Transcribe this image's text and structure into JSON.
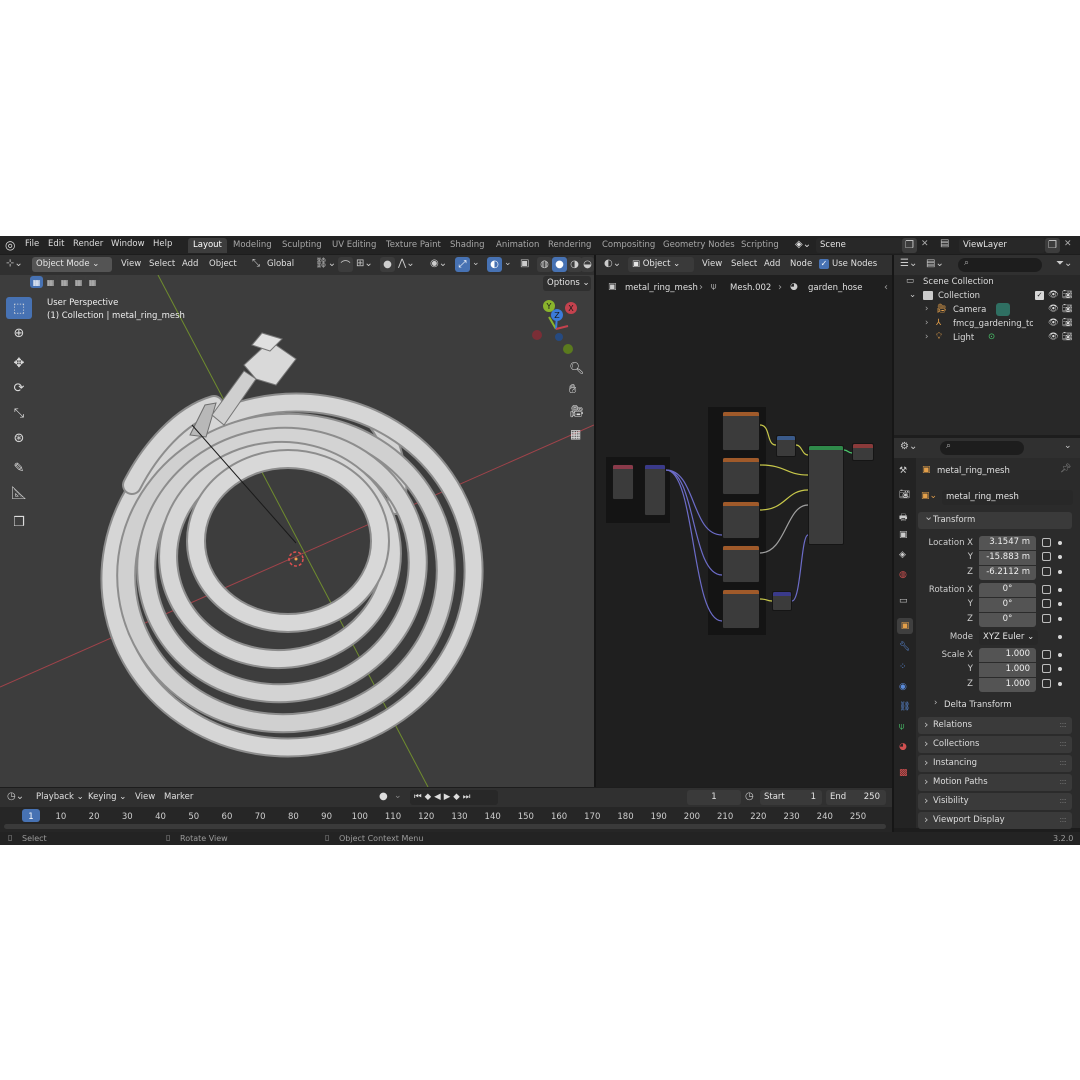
{
  "topbar": {
    "menus": [
      "File",
      "Edit",
      "Render",
      "Window",
      "Help"
    ],
    "workspaces": [
      "Layout",
      "Modeling",
      "Sculpting",
      "UV Editing",
      "Texture Paint",
      "Shading",
      "Animation",
      "Rendering",
      "Compositing",
      "Geometry Nodes",
      "Scripting"
    ],
    "active_workspace": "Layout",
    "scene": "Scene",
    "view_layer": "ViewLayer"
  },
  "viewport": {
    "mode": "Object Mode",
    "menus": [
      "View",
      "Select",
      "Add",
      "Object"
    ],
    "transform_orientation": "Global",
    "options_label": "Options",
    "perspective_label": "User Perspective",
    "collection_label": "(1) Collection | metal_ring_mesh",
    "gizmo_axes": [
      "X",
      "Y",
      "Z"
    ]
  },
  "node_editor": {
    "object_type": "Object",
    "menus": [
      "View",
      "Select",
      "Add",
      "Node"
    ],
    "use_nodes_label": "Use Nodes",
    "use_nodes_checked": true,
    "breadcrumb": [
      "metal_ring_mesh",
      "Mesh.002",
      "garden_hose"
    ]
  },
  "outliner": {
    "root": "Scene Collection",
    "items": [
      {
        "label": "Collection",
        "depth": 0
      },
      {
        "label": "Camera",
        "depth": 1
      },
      {
        "label": "fmcg_gardening_tool",
        "depth": 1
      },
      {
        "label": "Light",
        "depth": 1
      }
    ]
  },
  "properties": {
    "object_name": "metal_ring_mesh",
    "data_name": "metal_ring_mesh",
    "transform_title": "Transform",
    "location_label": "Location X",
    "location": [
      "3.1547 m",
      "-15.883 m",
      "-6.2112 m"
    ],
    "rotation_label": "Rotation X",
    "rotation": [
      "0°",
      "0°",
      "0°"
    ],
    "mode_label": "Mode",
    "rotation_mode": "XYZ Euler",
    "scale_label": "Scale X",
    "scale": [
      "1.000",
      "1.000",
      "1.000"
    ],
    "axis_y": "Y",
    "axis_z": "Z",
    "delta_transform": "Delta Transform",
    "panels": [
      "Relations",
      "Collections",
      "Instancing",
      "Motion Paths",
      "Visibility",
      "Viewport Display"
    ]
  },
  "timeline": {
    "menus": [
      "Playback",
      "Keying",
      "View",
      "Marker"
    ],
    "current_frame": "1",
    "start_label": "Start",
    "start": "1",
    "end_label": "End",
    "end": "250",
    "ticks": [
      "1",
      "10",
      "20",
      "30",
      "40",
      "50",
      "60",
      "70",
      "80",
      "90",
      "100",
      "110",
      "120",
      "130",
      "140",
      "150",
      "160",
      "170",
      "180",
      "190",
      "200",
      "210",
      "220",
      "230",
      "240",
      "250"
    ]
  },
  "statusbar": {
    "select": "Select",
    "rotate_view": "Rotate View",
    "context_menu": "Object Context Menu",
    "version": "3.2.0"
  },
  "colors": {
    "accent": "#4772b3",
    "x_axis": "#c4424e",
    "y_axis": "#8ab42c",
    "z_axis": "#3b7bd9"
  }
}
